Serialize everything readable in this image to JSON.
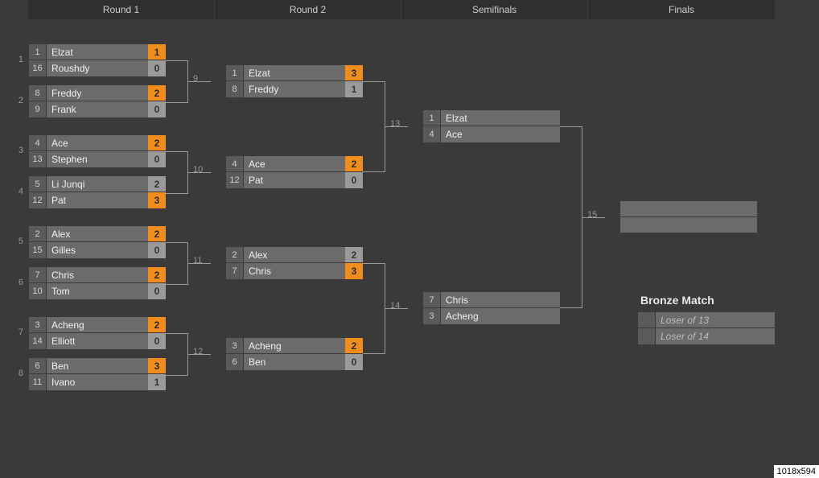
{
  "rounds": [
    {
      "label": "Round 1"
    },
    {
      "label": "Round 2"
    },
    {
      "label": "Semifinals"
    },
    {
      "label": "Finals"
    }
  ],
  "round1": [
    {
      "num": "1",
      "p": [
        {
          "seed": "1",
          "name": "Elzat",
          "score": "1",
          "win": true
        },
        {
          "seed": "16",
          "name": "Roushdy",
          "score": "0",
          "win": false
        }
      ]
    },
    {
      "num": "2",
      "p": [
        {
          "seed": "8",
          "name": "Freddy",
          "score": "2",
          "win": true
        },
        {
          "seed": "9",
          "name": "Frank",
          "score": "0",
          "win": false
        }
      ]
    },
    {
      "num": "3",
      "p": [
        {
          "seed": "4",
          "name": "Ace",
          "score": "2",
          "win": true
        },
        {
          "seed": "13",
          "name": "Stephen",
          "score": "0",
          "win": false
        }
      ]
    },
    {
      "num": "4",
      "p": [
        {
          "seed": "5",
          "name": "Li Junqi",
          "score": "2",
          "win": false
        },
        {
          "seed": "12",
          "name": "Pat",
          "score": "3",
          "win": true
        }
      ]
    },
    {
      "num": "5",
      "p": [
        {
          "seed": "2",
          "name": "Alex",
          "score": "2",
          "win": true
        },
        {
          "seed": "15",
          "name": "Gilles",
          "score": "0",
          "win": false
        }
      ]
    },
    {
      "num": "6",
      "p": [
        {
          "seed": "7",
          "name": "Chris",
          "score": "2",
          "win": true
        },
        {
          "seed": "10",
          "name": "Tom",
          "score": "0",
          "win": false
        }
      ]
    },
    {
      "num": "7",
      "p": [
        {
          "seed": "3",
          "name": "Acheng",
          "score": "2",
          "win": true
        },
        {
          "seed": "14",
          "name": "Elliott",
          "score": "0",
          "win": false
        }
      ]
    },
    {
      "num": "8",
      "p": [
        {
          "seed": "6",
          "name": "Ben",
          "score": "3",
          "win": true
        },
        {
          "seed": "11",
          "name": "Ivano",
          "score": "1",
          "win": false
        }
      ]
    }
  ],
  "round2": [
    {
      "num": "9",
      "p": [
        {
          "seed": "1",
          "name": "Elzat",
          "score": "3",
          "win": true
        },
        {
          "seed": "8",
          "name": "Freddy",
          "score": "1",
          "win": false
        }
      ]
    },
    {
      "num": "10",
      "p": [
        {
          "seed": "4",
          "name": "Ace",
          "score": "2",
          "win": true
        },
        {
          "seed": "12",
          "name": "Pat",
          "score": "0",
          "win": false
        }
      ]
    },
    {
      "num": "11",
      "p": [
        {
          "seed": "2",
          "name": "Alex",
          "score": "2",
          "win": false
        },
        {
          "seed": "7",
          "name": "Chris",
          "score": "3",
          "win": true
        }
      ]
    },
    {
      "num": "12",
      "p": [
        {
          "seed": "3",
          "name": "Acheng",
          "score": "2",
          "win": true
        },
        {
          "seed": "6",
          "name": "Ben",
          "score": "0",
          "win": false
        }
      ]
    }
  ],
  "semis": [
    {
      "num": "13",
      "p": [
        {
          "seed": "1",
          "name": "Elzat",
          "score": "",
          "win": null
        },
        {
          "seed": "4",
          "name": "Ace",
          "score": "",
          "win": null
        }
      ]
    },
    {
      "num": "14",
      "p": [
        {
          "seed": "7",
          "name": "Chris",
          "score": "",
          "win": null
        },
        {
          "seed": "3",
          "name": "Acheng",
          "score": "",
          "win": null
        }
      ]
    }
  ],
  "finals": {
    "num": "15"
  },
  "bronze": {
    "title": "Bronze Match",
    "p": [
      {
        "name": "Loser of 13"
      },
      {
        "name": "Loser of 14"
      }
    ]
  },
  "dim": "1018x594"
}
